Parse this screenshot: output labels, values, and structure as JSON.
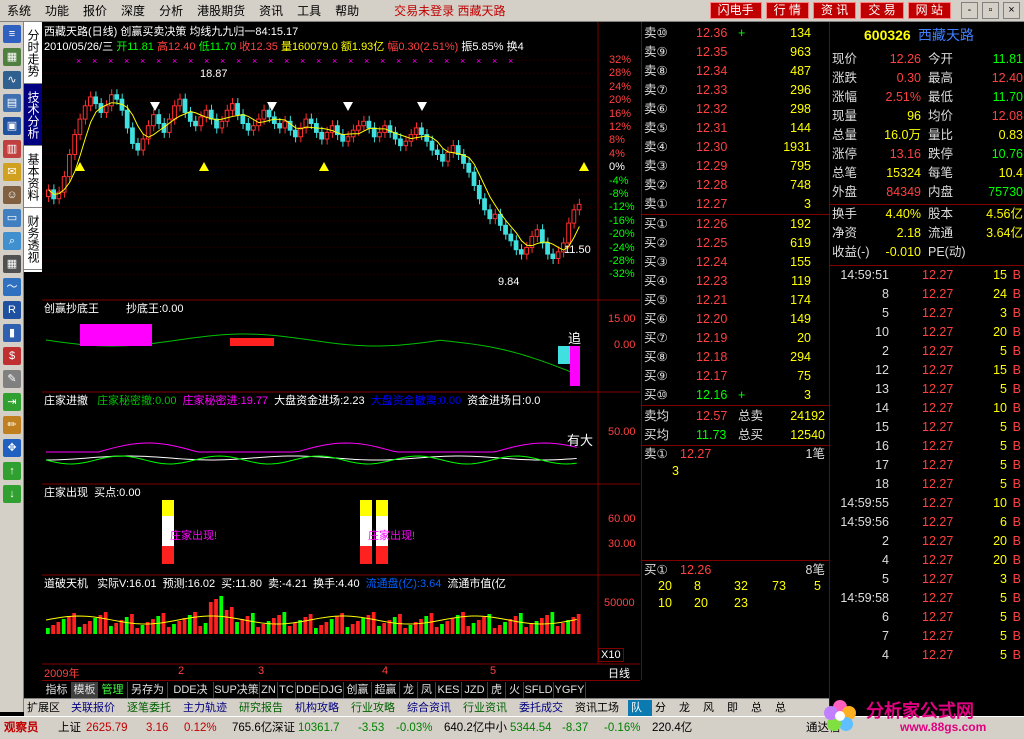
{
  "menu": {
    "items": [
      "系统",
      "功能",
      "报价",
      "深度",
      "分析",
      "港股期货",
      "资讯",
      "工具",
      "帮助"
    ],
    "status": "交易未登录  西藏天路",
    "buttons": [
      "闪电手",
      "行 情",
      "资 讯",
      "交 易",
      "网 站"
    ],
    "window_controls": [
      "-",
      "▫",
      "×"
    ]
  },
  "vtabs": [
    "分时走势",
    "技术分析",
    "基本资料",
    "财务透视"
  ],
  "chart": {
    "title": "西藏天路(日线)  创赢买卖决策  均线九九归一84:15.17",
    "ohlc": {
      "date": "2010/05/26/三",
      "open_label": "开",
      "open": "11.81",
      "high_label": "高",
      "high": "12.40",
      "low_label": "低",
      "low": "11.70",
      "close_label": "收",
      "close": "12.35",
      "vol_label": "量",
      "vol": "160079.0",
      "amt_label": "额",
      "amt": "1.93亿",
      "chg_label": "幅",
      "chg": "0.30(2.51%)",
      "amp_label": "振",
      "amp": "5.85%",
      "turn_label": "换",
      "turn": "4"
    },
    "price_axis": [
      "32%",
      "28%",
      "24%",
      "20%",
      "16%",
      "12%",
      "8%",
      "4%",
      "0%",
      "-4%",
      "-8%",
      "-12%",
      "-16%",
      "-20%",
      "-24%",
      "-28%",
      "-32%"
    ],
    "high_mark": "18.87",
    "low_mark": "9.84",
    "last_mark": "11.50",
    "panel2": {
      "name": "创赢抄底王",
      "label": "抄底王:0.00",
      "axis": [
        "15.00",
        "0.00"
      ],
      "tag": "追"
    },
    "panel3": {
      "name": "庄家进撤",
      "lines": [
        {
          "text": "庄家秘密撤:0.00",
          "color": "#00c000"
        },
        {
          "text": "庄家秘密进:19.77",
          "color": "#ff00ff"
        },
        {
          "text": "大盘资金进场:2.23",
          "color": "#ffffff"
        },
        {
          "text": "大盘资金撤离:0.00",
          "color": "#0000ff"
        },
        {
          "text": "资金进场日:0.0",
          "color": "#ffffff"
        }
      ],
      "axis": [
        "50.00"
      ],
      "tag": "有大"
    },
    "panel4": {
      "name": "庄家出现",
      "label": "买点:0.00",
      "axis": [
        "60.00",
        "30.00"
      ],
      "event": "庄家出现!"
    },
    "panel5": {
      "name": "道破天机",
      "lines": [
        {
          "text": "实际V:16.01",
          "color": "#ffffff"
        },
        {
          "text": "预测:16.02",
          "color": "#ffffff"
        },
        {
          "text": "买:11.80",
          "color": "#ffffff"
        },
        {
          "text": "卖:-4.21",
          "color": "#ffffff"
        },
        {
          "text": "换手:4.40",
          "color": "#ffffff"
        },
        {
          "text": "流通盘(亿):3.64",
          "color": "#0060ff"
        },
        {
          "text": "流通市值(亿",
          "color": "#ffffff"
        }
      ],
      "axis": [
        "50000"
      ],
      "scale": "X10"
    },
    "time_axis": [
      "2009年",
      "2",
      "3",
      "4",
      "5"
    ],
    "period": "日线"
  },
  "bottom_tabs": [
    "指标",
    "模板",
    "管理",
    "另存为",
    "DDE决策",
    "SUP决策",
    "ZN",
    "TC",
    "DDE",
    "DJG",
    "创赢",
    "超赢",
    "龙",
    "凤",
    "KES",
    "JZD",
    "虎",
    "火",
    "SFLD",
    "YGFY"
  ],
  "toolbar2": [
    "扩展区",
    "关联报价",
    "逐笔委托",
    "主力轨迹",
    "研究报告",
    "机构攻略",
    "行业攻略",
    "综合资讯",
    "行业资讯",
    "委托成交",
    "资讯工场",
    "队列",
    "分布",
    "龙虎",
    "风向",
    "即撤",
    "总撤",
    "总委"
  ],
  "orderbook": {
    "asks": [
      {
        "label": "卖⑩",
        "price": "12.36",
        "flag": "+",
        "vol": "134"
      },
      {
        "label": "卖⑨",
        "price": "12.35",
        "flag": "",
        "vol": "963"
      },
      {
        "label": "卖⑧",
        "price": "12.34",
        "flag": "",
        "vol": "487"
      },
      {
        "label": "卖⑦",
        "price": "12.33",
        "flag": "",
        "vol": "296"
      },
      {
        "label": "卖⑥",
        "price": "12.32",
        "flag": "",
        "vol": "298"
      },
      {
        "label": "卖⑤",
        "price": "12.31",
        "flag": "",
        "vol": "144"
      },
      {
        "label": "卖④",
        "price": "12.30",
        "flag": "",
        "vol": "1931"
      },
      {
        "label": "卖③",
        "price": "12.29",
        "flag": "",
        "vol": "795"
      },
      {
        "label": "卖②",
        "price": "12.28",
        "flag": "",
        "vol": "748"
      },
      {
        "label": "卖①",
        "price": "12.27",
        "flag": "",
        "vol": "3"
      }
    ],
    "bids": [
      {
        "label": "买①",
        "price": "12.26",
        "vol": "192"
      },
      {
        "label": "买②",
        "price": "12.25",
        "vol": "619"
      },
      {
        "label": "买③",
        "price": "12.24",
        "vol": "155"
      },
      {
        "label": "买④",
        "price": "12.23",
        "vol": "119"
      },
      {
        "label": "买⑤",
        "price": "12.21",
        "vol": "174"
      },
      {
        "label": "买⑥",
        "price": "12.20",
        "vol": "149"
      },
      {
        "label": "买⑦",
        "price": "12.19",
        "vol": "20"
      },
      {
        "label": "买⑧",
        "price": "12.18",
        "vol": "294"
      },
      {
        "label": "买⑨",
        "price": "12.17",
        "vol": "75"
      },
      {
        "label": "买⑩",
        "price": "12.16",
        "flag": "+",
        "vol": "3"
      }
    ],
    "avg_sell_label": "卖均",
    "avg_sell": "12.57",
    "total_sell_label": "总卖",
    "total_sell": "24192",
    "avg_buy_label": "买均",
    "avg_buy": "11.73",
    "total_buy_label": "总买",
    "total_buy": "12540",
    "queue_sell": {
      "label": "卖①",
      "price": "12.27",
      "count": "1笔",
      "items": [
        "3"
      ]
    },
    "queue_buy": {
      "label": "买①",
      "price": "12.26",
      "count": "8笔",
      "items": [
        "20",
        "8",
        "32",
        "73",
        "5",
        "10",
        "20",
        "23"
      ]
    }
  },
  "quote": {
    "code": "600326",
    "name": "西藏天路",
    "rows": [
      {
        "l1": "现价",
        "v1": "12.26",
        "c1": "#ff4040",
        "l2": "今开",
        "v2": "11.81",
        "c2": "#00ff00"
      },
      {
        "l1": "涨跌",
        "v1": "0.30",
        "c1": "#ff4040",
        "l2": "最高",
        "v2": "12.40",
        "c2": "#ff4040"
      },
      {
        "l1": "涨幅",
        "v1": "2.51%",
        "c1": "#ff4040",
        "l2": "最低",
        "v2": "11.70",
        "c2": "#00ff00"
      },
      {
        "l1": "现量",
        "v1": "96",
        "c1": "#ffff00",
        "l2": "均价",
        "v2": "12.08",
        "c2": "#ff4040"
      },
      {
        "l1": "总量",
        "v1": "16.0万",
        "c1": "#ffff00",
        "l2": "量比",
        "v2": "0.83",
        "c2": "#ffff00"
      },
      {
        "l1": "涨停",
        "v1": "13.16",
        "c1": "#ff4040",
        "l2": "跌停",
        "v2": "10.76",
        "c2": "#00ff00"
      },
      {
        "l1": "总笔",
        "v1": "15324",
        "c1": "#ffff00",
        "l2": "每笔",
        "v2": "10.4",
        "c2": "#ffff00"
      },
      {
        "l1": "外盘",
        "v1": "84349",
        "c1": "#ff4040",
        "l2": "内盘",
        "v2": "75730",
        "c2": "#00ff00"
      }
    ],
    "rows2": [
      {
        "l1": "换手",
        "v1": "4.40%",
        "c1": "#ffff00",
        "l2": "股本",
        "v2": "4.56亿",
        "c2": "#ffff00"
      },
      {
        "l1": "净资",
        "v1": "2.18",
        "c1": "#ffff00",
        "l2": "流通",
        "v2": "3.64亿",
        "c2": "#ffff00"
      },
      {
        "l1": "收益(-)",
        "v1": "-0.010",
        "c1": "#ffff00",
        "l2": "PE(动)",
        "v2": "",
        "c2": "#ffff00"
      }
    ],
    "ticks": [
      {
        "t": "14:59:51",
        "p": "12.27",
        "v": "15",
        "s": "B"
      },
      {
        "t": "8",
        "p": "12.27",
        "v": "24",
        "s": "B"
      },
      {
        "t": "5",
        "p": "12.27",
        "v": "3",
        "s": "B"
      },
      {
        "t": "10",
        "p": "12.27",
        "v": "20",
        "s": "B"
      },
      {
        "t": "2",
        "p": "12.27",
        "v": "5",
        "s": "B"
      },
      {
        "t": "12",
        "p": "12.27",
        "v": "15",
        "s": "B"
      },
      {
        "t": "13",
        "p": "12.27",
        "v": "5",
        "s": "B"
      },
      {
        "t": "14",
        "p": "12.27",
        "v": "10",
        "s": "B"
      },
      {
        "t": "15",
        "p": "12.27",
        "v": "5",
        "s": "B"
      },
      {
        "t": "16",
        "p": "12.27",
        "v": "5",
        "s": "B"
      },
      {
        "t": "17",
        "p": "12.27",
        "v": "5",
        "s": "B"
      },
      {
        "t": "18",
        "p": "12.27",
        "v": "5",
        "s": "B"
      },
      {
        "t": "14:59:55",
        "p": "12.27",
        "v": "10",
        "s": "B"
      },
      {
        "t": "14:59:56",
        "p": "12.27",
        "v": "6",
        "s": "B"
      },
      {
        "t": "2",
        "p": "12.27",
        "v": "20",
        "s": "B"
      },
      {
        "t": "4",
        "p": "12.27",
        "v": "20",
        "s": "B"
      },
      {
        "t": "5",
        "p": "12.27",
        "v": "3",
        "s": "B"
      },
      {
        "t": "14:59:58",
        "p": "12.27",
        "v": "5",
        "s": "B"
      },
      {
        "t": "6",
        "p": "12.27",
        "v": "5",
        "s": "B"
      },
      {
        "t": "7",
        "p": "12.27",
        "v": "5",
        "s": "B"
      },
      {
        "t": "4",
        "p": "12.27",
        "v": "5",
        "s": "B"
      }
    ]
  },
  "status": {
    "user": "观察员",
    "sh_label": "上证",
    "sh": "2625.79",
    "sh_chg": "3.16",
    "sh_pct": "0.12%",
    "sh_amt": "765.6亿",
    "sz_label": "深证",
    "sz": "10361.7",
    "sz_chg": "-3.53",
    "sz_pct": "-0.03%",
    "sz_amt": "640.2亿",
    "zx_label": "中小",
    "zx": "5344.54",
    "zx_chg": "-8.37",
    "zx_pct": "-0.16%",
    "zx_amt": "220.4亿",
    "info": "通达信"
  },
  "logo": {
    "text": "分析家公式网",
    "url": "www.88gs.com"
  }
}
